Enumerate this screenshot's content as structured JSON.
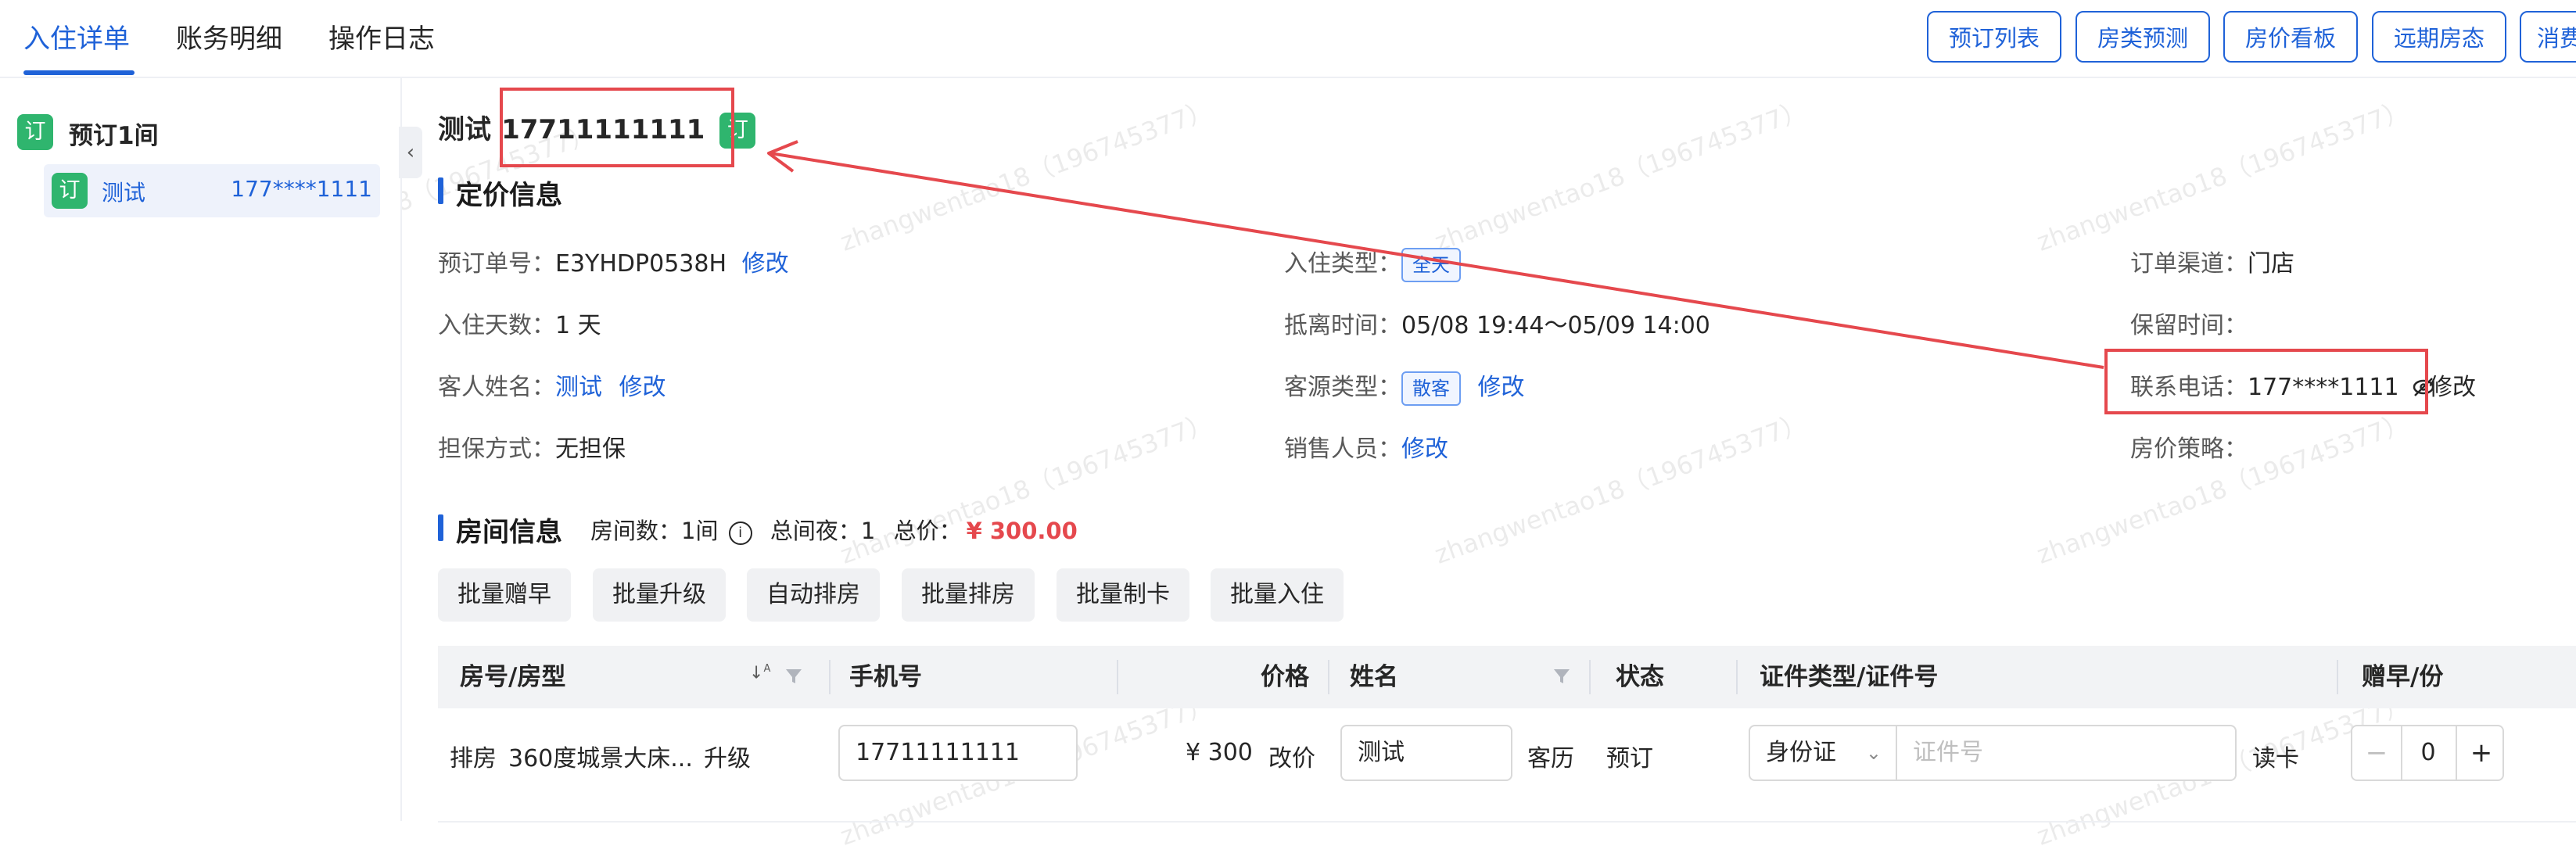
{
  "tabs": [
    "入住详单",
    "账务明细",
    "操作日志"
  ],
  "top_buttons": [
    "预订列表",
    "房类预测",
    "房价看板",
    "远期房态",
    "消费"
  ],
  "sidebar": {
    "group_badge": "订",
    "group_title": "预订1间",
    "item_badge": "订",
    "item_name": "测试",
    "item_phone": "177****1111"
  },
  "header": {
    "name": "测试",
    "phone": "17711111111",
    "badge": "订"
  },
  "pricing": {
    "title": "定价信息",
    "fields": {
      "order_no_label": "预订单号：",
      "order_no": "E3YHDP0538H",
      "order_no_edit": "修改",
      "checkin_type_label": "入住类型：",
      "checkin_type": "全天",
      "channel_label": "订单渠道：",
      "channel": "门店",
      "days_label": "入住天数：",
      "days": "1 天",
      "time_label": "抵离时间：",
      "time": "05/08 19:44～05/09 14:00",
      "hold_label": "保留时间：",
      "guest_label": "客人姓名：",
      "guest": "测试",
      "guest_edit": "修改",
      "source_label": "客源类型：",
      "source": "散客",
      "source_edit": "修改",
      "contact_label": "联系电话：",
      "contact": "177****1111",
      "contact_edit": "修改",
      "guarantee_label": "担保方式：",
      "guarantee": "无担保",
      "sales_label": "销售人员：",
      "sales_edit": "修改",
      "policy_label": "房价策略："
    }
  },
  "rooms": {
    "title": "房间信息",
    "summary_rooms": "房间数：1间",
    "summary_nights": "总间夜：1",
    "summary_total_label": "总价：",
    "summary_total": "¥ 300.00",
    "batch_buttons": [
      "批量赠早",
      "批量升级",
      "自动排房",
      "批量排房",
      "批量制卡",
      "批量入住"
    ]
  },
  "table": {
    "headers": {
      "room": "房号/房型",
      "phone": "手机号",
      "price": "价格",
      "name": "姓名",
      "status": "状态",
      "id": "证件类型/证件号",
      "breakfast": "赠早/份"
    },
    "row": {
      "assign": "排房",
      "room_type": "360度城景大床...",
      "upgrade": "升级",
      "phone": "17711111111",
      "price": "¥ 300",
      "price_edit": "改价",
      "name": "测试",
      "history": "客历",
      "status": "预订",
      "id_type": "身份证",
      "id_placeholder": "证件号",
      "read_card": "读卡",
      "breakfast_count": "0"
    }
  },
  "watermark": "zhangwentao18（196745377）",
  "colors": {
    "accent": "#1f62d8",
    "badge_green": "#2fb56e",
    "price_red": "#e5484d",
    "annotation_red": "#e5484d"
  }
}
